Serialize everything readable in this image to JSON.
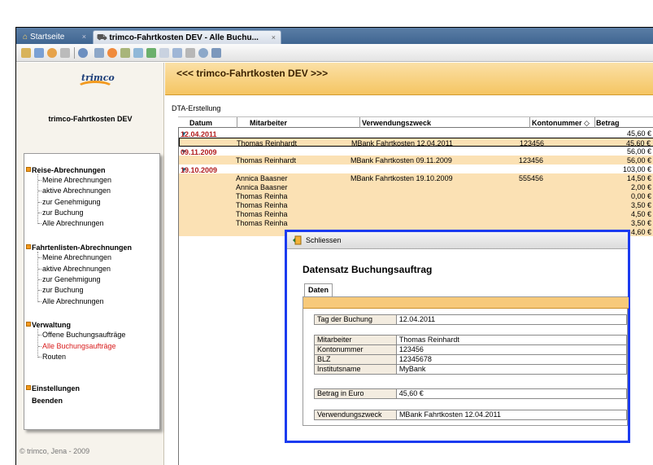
{
  "tabs": [
    {
      "label": "Startseite",
      "close": "×"
    },
    {
      "label": "trimco-Fahrtkosten DEV - Alle Buchu...",
      "close": "×"
    }
  ],
  "sidebar": {
    "logo_text": "trimco",
    "app_title": "trimco-Fahrtkosten DEV",
    "groups": [
      {
        "label": "Reise-Abrechnungen",
        "items": [
          "Meine Abrechnungen",
          "aktive Abrechnungen",
          "zur Genehmigung",
          "zur Buchung",
          "Alle Abrechnungen"
        ]
      },
      {
        "label": "Fahrtenlisten-Abrechnungen",
        "items": [
          "Meine Abrechnungen",
          "aktive Abrechnungen",
          "zur Genehmigung",
          "zur Buchung",
          "Alle Abrechnungen"
        ]
      },
      {
        "label": "Verwaltung",
        "items": [
          "Offene Buchungsaufträge",
          "Alle Buchungsaufträge",
          "Routen"
        ]
      },
      {
        "label": "Einstellungen",
        "items": []
      },
      {
        "label": "Beenden",
        "items": []
      }
    ],
    "copyright": "© trimco, Jena - 2009"
  },
  "main": {
    "banner_title": "<<< trimco-Fahrtkosten DEV >>>",
    "breadcrumb": "DTA-Erstellung",
    "columns": [
      "Datum",
      "Mitarbeiter",
      "Verwendungszweck",
      "Kontonummer ◇",
      "Betrag"
    ],
    "rows": [
      {
        "type": "group",
        "date": "12.04.2011",
        "sum": "45,60 €"
      },
      {
        "type": "data",
        "emp": "Thomas Reinhardt",
        "purpose": "MBank Fahrtkosten 12.04.2011",
        "account": "123456",
        "amount": "45,60 €"
      },
      {
        "type": "group",
        "date": "09.11.2009",
        "sum": "56,00 €"
      },
      {
        "type": "data",
        "emp": "Thomas Reinhardt",
        "purpose": "MBank Fahrtkosten 09.11.2009",
        "account": "123456",
        "amount": "56,00 €"
      },
      {
        "type": "group",
        "date": "19.10.2009",
        "sum": "103,00 €"
      },
      {
        "type": "data",
        "emp": "Annica Baasner",
        "purpose": "MBank Fahrtkosten 19.10.2009",
        "account": "555456",
        "amount": "14,50 €"
      },
      {
        "type": "data",
        "emp": "Annica Baasner",
        "purpose": "",
        "account": "",
        "amount": "2,00 €"
      },
      {
        "type": "data",
        "emp": "Thomas Reinha",
        "purpose": "",
        "account": "",
        "amount": "0,00 €"
      },
      {
        "type": "data",
        "emp": "Thomas Reinha",
        "purpose": "",
        "account": "",
        "amount": "3,50 €"
      },
      {
        "type": "data",
        "emp": "Thomas Reinha",
        "purpose": "",
        "account": "",
        "amount": "4,50 €"
      },
      {
        "type": "data",
        "emp": "Thomas Reinha",
        "purpose": "",
        "account": "",
        "amount": "3,50 €"
      },
      {
        "type": "data",
        "emp": "",
        "purpose": "",
        "account": "",
        "amount": "4,60 €"
      }
    ]
  },
  "dialog": {
    "close_label": "Schliessen",
    "title": "Datensatz Buchungsauftrag",
    "tab_label": "Daten",
    "booking": [
      {
        "k": "Tag der Buchung",
        "v": "12.04.2011"
      }
    ],
    "person": [
      {
        "k": "Mitarbeiter",
        "v": "Thomas Reinhardt"
      },
      {
        "k": "Kontonummer",
        "v": "123456"
      },
      {
        "k": "BLZ",
        "v": "12345678"
      },
      {
        "k": "Institutsname",
        "v": "MyBank"
      }
    ],
    "amount": [
      {
        "k": "Betrag in Euro",
        "v": "45,60 €"
      }
    ],
    "purpose": [
      {
        "k": "Verwendungszweck",
        "v": "MBank Fahrtkosten 12.04.2011"
      }
    ]
  },
  "colors": {
    "accent_orange": "#f39a1f",
    "dialog_border": "#1b3bf0",
    "active_item": "#d81b1b",
    "tabbar_blue": "#3f6591"
  }
}
